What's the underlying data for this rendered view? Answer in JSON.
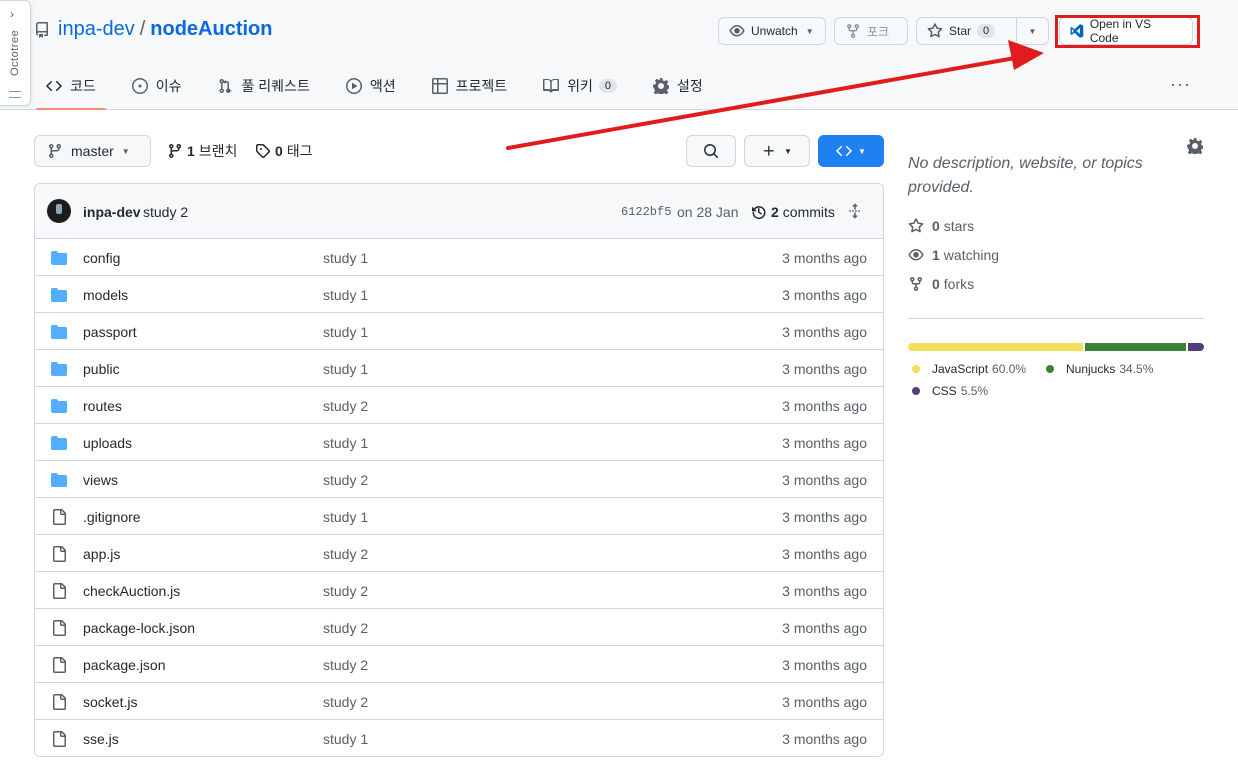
{
  "repo": {
    "owner": "inpa-dev",
    "separator": "/",
    "name": "nodeAuction"
  },
  "header_buttons": {
    "unwatch": "Unwatch",
    "fork": "포크",
    "star": "Star",
    "star_count": "0",
    "vscode": "Open in VS Code"
  },
  "tabs": [
    {
      "label": "코드",
      "icon": "code-icon",
      "active": true
    },
    {
      "label": "이슈",
      "icon": "issue-icon"
    },
    {
      "label": "풀 리퀘스트",
      "icon": "pull-request-icon"
    },
    {
      "label": "액션",
      "icon": "play-icon"
    },
    {
      "label": "프로젝트",
      "icon": "table-icon"
    },
    {
      "label": "위키",
      "icon": "book-icon",
      "count": "0"
    },
    {
      "label": "설정",
      "icon": "gear-icon"
    }
  ],
  "more_label": "···",
  "branch": {
    "name": "master",
    "branches_count": "1",
    "branches_label": "브랜치",
    "tags_count": "0",
    "tags_label": "태그"
  },
  "latest_commit": {
    "author": "inpa-dev",
    "message": "study 2",
    "sha": "6122bf5",
    "date": "on 28 Jan",
    "commits_count": "2",
    "commits_label": "commits"
  },
  "files": [
    {
      "type": "dir",
      "name": "config",
      "message": "study 1",
      "date": "3 months ago"
    },
    {
      "type": "dir",
      "name": "models",
      "message": "study 1",
      "date": "3 months ago"
    },
    {
      "type": "dir",
      "name": "passport",
      "message": "study 1",
      "date": "3 months ago"
    },
    {
      "type": "dir",
      "name": "public",
      "message": "study 1",
      "date": "3 months ago"
    },
    {
      "type": "dir",
      "name": "routes",
      "message": "study 2",
      "date": "3 months ago"
    },
    {
      "type": "dir",
      "name": "uploads",
      "message": "study 1",
      "date": "3 months ago"
    },
    {
      "type": "dir",
      "name": "views",
      "message": "study 2",
      "date": "3 months ago"
    },
    {
      "type": "file",
      "name": ".gitignore",
      "message": "study 1",
      "date": "3 months ago"
    },
    {
      "type": "file",
      "name": "app.js",
      "message": "study 2",
      "date": "3 months ago"
    },
    {
      "type": "file",
      "name": "checkAuction.js",
      "message": "study 2",
      "date": "3 months ago"
    },
    {
      "type": "file",
      "name": "package-lock.json",
      "message": "study 2",
      "date": "3 months ago"
    },
    {
      "type": "file",
      "name": "package.json",
      "message": "study 2",
      "date": "3 months ago"
    },
    {
      "type": "file",
      "name": "socket.js",
      "message": "study 2",
      "date": "3 months ago"
    },
    {
      "type": "file",
      "name": "sse.js",
      "message": "study 1",
      "date": "3 months ago"
    }
  ],
  "about": {
    "description": "No description, website, or topics provided.",
    "stars_count": "0",
    "stars_label": "stars",
    "watching_count": "1",
    "watching_label": "watching",
    "forks_count": "0",
    "forks_label": "forks"
  },
  "languages": [
    {
      "name": "JavaScript",
      "percent": "60.0%",
      "value": 60.0,
      "color": "#f1e05a"
    },
    {
      "name": "Nunjucks",
      "percent": "34.5%",
      "value": 34.5,
      "color": "#3d8137"
    },
    {
      "name": "CSS",
      "percent": "5.5%",
      "value": 5.5,
      "color": "#563d7c"
    }
  ],
  "octotree_label": "Octotree",
  "colors": {
    "accent_blue": "#0969da",
    "code_button": "#1f80f0",
    "annotation_red": "#e21c1c"
  }
}
